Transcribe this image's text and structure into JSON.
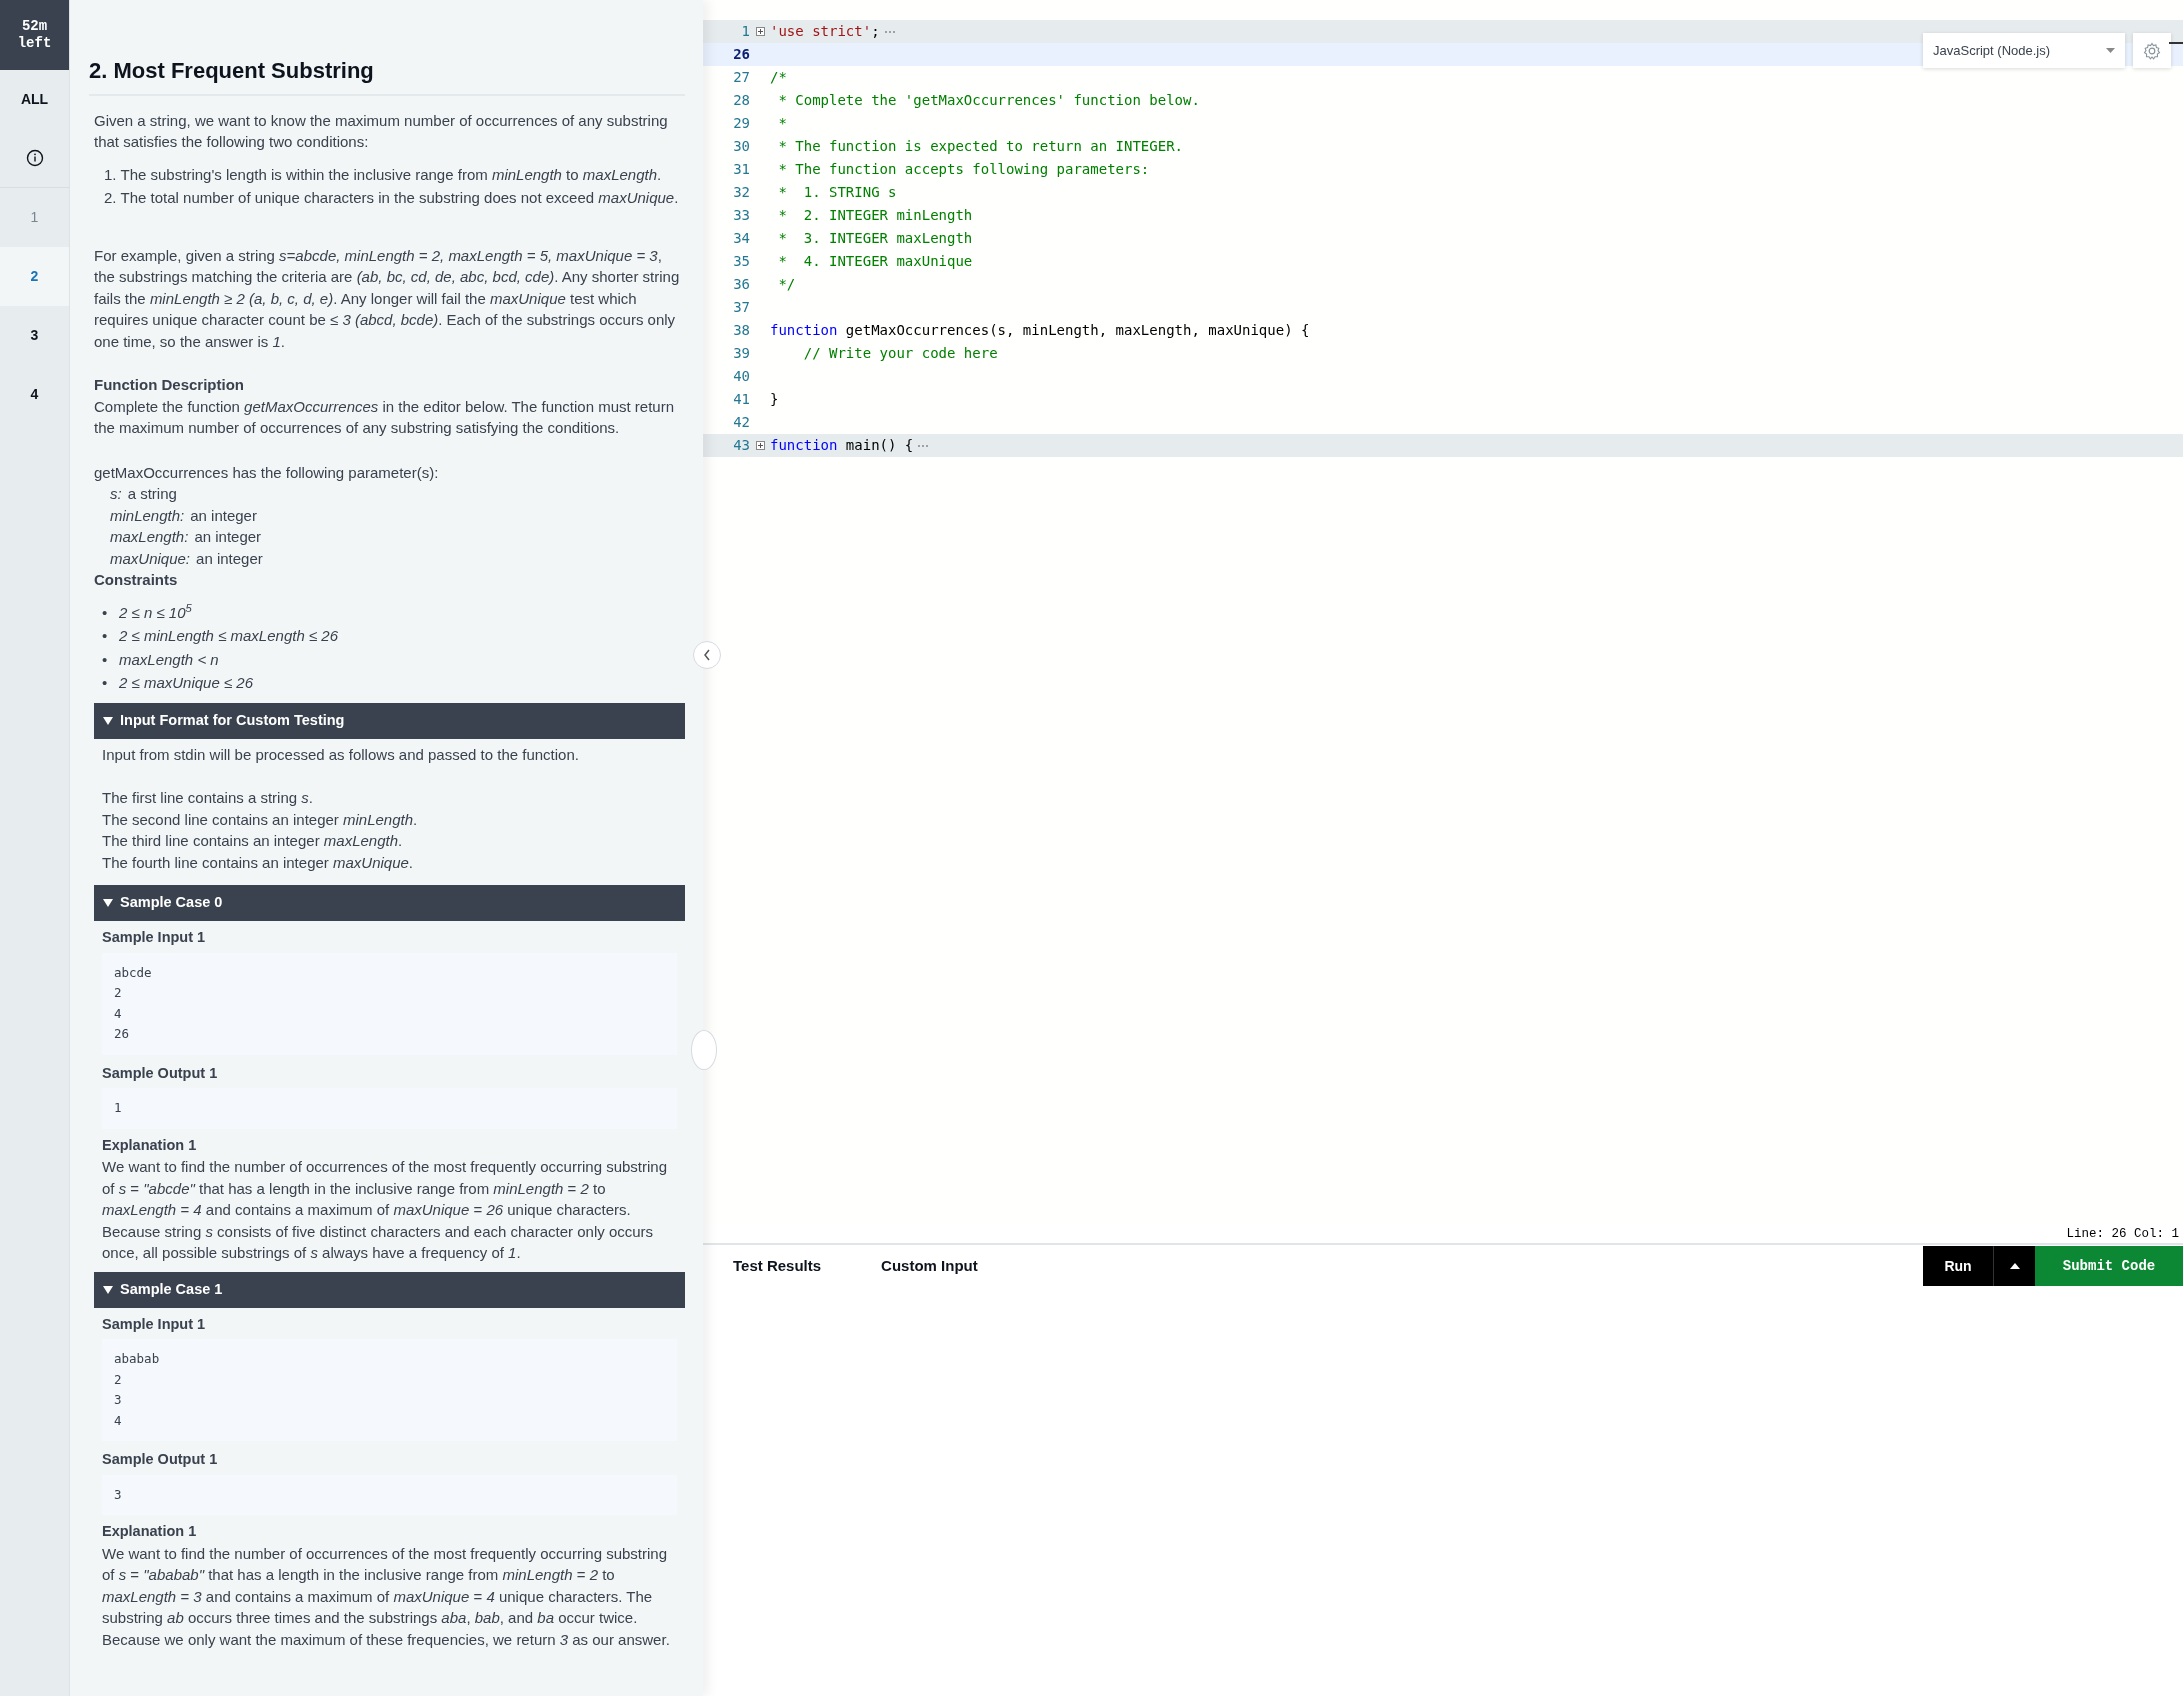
{
  "timer": "52m left",
  "nav": [
    {
      "kind": "text",
      "label": "ALL",
      "selected": false,
      "visited": false
    },
    {
      "kind": "info",
      "selected": false,
      "visited": false
    },
    {
      "kind": "text",
      "label": "1",
      "selected": false,
      "visited": true
    },
    {
      "kind": "text",
      "label": "2",
      "selected": true,
      "visited": false
    },
    {
      "kind": "text",
      "label": "3",
      "selected": false,
      "visited": false
    },
    {
      "kind": "text",
      "label": "4",
      "selected": false,
      "visited": false
    }
  ],
  "problem": {
    "title": "2. Most Frequent Substring",
    "intro": "Given a string, we want to know the maximum number of occurrences of any substring that satisfies the following two conditions:",
    "conditions": [
      {
        "marker": "1.",
        "text": "The substring's length is within the inclusive range from *minLength* to *maxLength*."
      },
      {
        "marker": "2.",
        "text": "The total number of unique characters in the substring does not exceed *maxUnique*."
      }
    ],
    "example": "For example, given a string *s=abcde, minLength = 2, maxLength = 5, maxUnique = 3*, the substrings matching the criteria are *(ab, bc, cd, de, abc, bcd, cde)*. Any shorter string fails the *minLength ≥ 2 (a, b, c, d, e)*. Any longer will fail the *maxUnique* test which requires unique character count be *≤ 3 (abcd, bcde)*. Each of the substrings occurs only one time, so the answer is *1*.",
    "function_description": {
      "heading": "Function Description",
      "text": "Complete the function *getMaxOccurrences* in the editor below. The function must return the maximum number of occurrences of any substring satisfying the conditions."
    },
    "params_intro": "getMaxOccurrences has the following parameter(s):",
    "params": [
      {
        "name": "s:",
        "desc": "a string"
      },
      {
        "name": "minLength:",
        "desc": "an integer"
      },
      {
        "name": "maxLength:",
        "desc": "an integer"
      },
      {
        "name": "maxUnique:",
        "desc": "an integer"
      }
    ],
    "constraints": {
      "heading": "Constraints",
      "items": [
        {
          "marker": "•",
          "text": "2 ≤ n ≤ 10$^{5}$"
        },
        {
          "marker": "•",
          "text": "2 ≤ minLength ≤ maxLength ≤ 26"
        },
        {
          "marker": "•",
          "text": "maxLength < n"
        },
        {
          "marker": "•",
          "text": "2 ≤ maxUnique ≤ 26"
        }
      ]
    },
    "sections": [
      {
        "kind": "text",
        "title": "Input Format for Custom Testing",
        "expanded": true,
        "intro": "Input from stdin will be processed as follows and passed to the function.",
        "lines": [
          "The first line contains a string *s*.",
          "The second line contains an integer *minLength*.",
          "The third line contains an integer *maxLength*.",
          "The fourth line contains an integer *maxUnique*."
        ]
      },
      {
        "kind": "sample",
        "title": "Sample Case 0",
        "expanded": true,
        "input_label": "Sample Input 1",
        "input": [
          "abcde",
          "2",
          "4",
          "26"
        ],
        "output_label": "Sample Output 1",
        "output": [
          "1"
        ],
        "explanation_label": "Explanation 1",
        "explanation": "We want to find the number of occurrences of the most frequently occurring substring of *s* = *\"abcde\"* that has a length in the inclusive range from *minLength* = *2* to *maxLength* = *4* and contains a maximum of *maxUnique* = *26* unique characters. Because string *s* consists of five distinct characters and each character only occurs once, all possible substrings of *s* always have a frequency of *1*."
      },
      {
        "kind": "sample",
        "title": "Sample Case 1",
        "expanded": true,
        "input_label": "Sample Input 1",
        "input": [
          "ababab",
          "2",
          "3",
          "4"
        ],
        "output_label": "Sample Output 1",
        "output": [
          "3"
        ],
        "explanation_label": "Explanation 1",
        "explanation": "We want to find the number of occurrences of the most frequently occurring substring of *s* = *\"ababab\"* that has a length in the inclusive range from *minLength* = *2* to *maxLength* = *3* and contains a maximum of *maxUnique* = *4* unique characters. The substring *ab* occurs three times and the substrings *aba*, *bab*, and *ba* occur twice. Because we only want the maximum of these frequencies, we return *3* as our answer."
      }
    ]
  },
  "editor": {
    "language": "JavaScript (Node.js)",
    "lines": [
      {
        "number": "1",
        "folded": true,
        "current": false,
        "tokens": [
          {
            "kind": "string",
            "text": "'use strict'"
          },
          {
            "kind": "plain",
            "text": ";"
          }
        ]
      },
      {
        "number": "26",
        "folded": false,
        "current": true
      },
      {
        "number": "27",
        "folded": false,
        "current": false,
        "tokens": [
          {
            "kind": "comment",
            "text": "/*"
          }
        ]
      },
      {
        "number": "28",
        "folded": false,
        "current": false,
        "tokens": [
          {
            "kind": "comment",
            "text": " * Complete the 'getMaxOccurrences' function below."
          }
        ]
      },
      {
        "number": "29",
        "folded": false,
        "current": false,
        "tokens": [
          {
            "kind": "comment",
            "text": " *"
          }
        ]
      },
      {
        "number": "30",
        "folded": false,
        "current": false,
        "tokens": [
          {
            "kind": "comment",
            "text": " * The function is expected to return an INTEGER."
          }
        ]
      },
      {
        "number": "31",
        "folded": false,
        "current": false,
        "tokens": [
          {
            "kind": "comment",
            "text": " * The function accepts following parameters:"
          }
        ]
      },
      {
        "number": "32",
        "folded": false,
        "current": false,
        "tokens": [
          {
            "kind": "comment",
            "text": " *  1. STRING s"
          }
        ]
      },
      {
        "number": "33",
        "folded": false,
        "current": false,
        "tokens": [
          {
            "kind": "comment",
            "text": " *  2. INTEGER minLength"
          }
        ]
      },
      {
        "number": "34",
        "folded": false,
        "current": false,
        "tokens": [
          {
            "kind": "comment",
            "text": " *  3. INTEGER maxLength"
          }
        ]
      },
      {
        "number": "35",
        "folded": false,
        "current": false,
        "tokens": [
          {
            "kind": "comment",
            "text": " *  4. INTEGER maxUnique"
          }
        ]
      },
      {
        "number": "36",
        "folded": false,
        "current": false,
        "tokens": [
          {
            "kind": "comment",
            "text": " */"
          }
        ]
      },
      {
        "number": "37",
        "folded": false,
        "current": false
      },
      {
        "number": "38",
        "folded": false,
        "current": false,
        "tokens": [
          {
            "kind": "keyword",
            "text": "function"
          },
          {
            "kind": "plain",
            "text": " getMaxOccurrences(s, minLength, maxLength, maxUnique) {"
          }
        ]
      },
      {
        "number": "39",
        "folded": false,
        "current": false,
        "tokens": [
          {
            "kind": "comment",
            "text": "    // Write your code here"
          }
        ]
      },
      {
        "number": "40",
        "folded": false,
        "current": false
      },
      {
        "number": "41",
        "folded": false,
        "current": false,
        "tokens": [
          {
            "kind": "plain",
            "text": "}"
          }
        ]
      },
      {
        "number": "42",
        "folded": false,
        "current": false
      },
      {
        "number": "43",
        "folded": true,
        "current": false,
        "tokens": [
          {
            "kind": "keyword",
            "text": "function"
          },
          {
            "kind": "plain",
            "text": " main() {"
          }
        ]
      }
    ],
    "status": "Line: 26 Col: 1"
  },
  "bottom": {
    "tabs": [
      {
        "label": "Test Results"
      },
      {
        "label": "Custom Input"
      }
    ],
    "run": "Run",
    "submit": "Submit Code"
  }
}
